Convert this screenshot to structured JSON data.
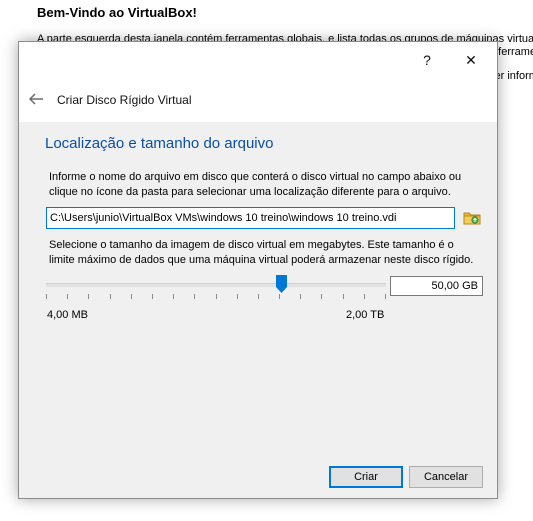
{
  "background": {
    "title": "Bem-Vindo ao VirtualBox!",
    "line1": "A parte esquerda desta janela contém ferramentas globais, e lista todas os grupos de máquinas virtuais",
    "frag1": "e ferrame",
    "frag2": "zer inform"
  },
  "dialog": {
    "help_label": "?",
    "close_label": "✕",
    "header_title": "Criar Disco Rígido Virtual",
    "page_title": "Localização e tamanho do arquivo",
    "description": "Informe o nome do arquivo em disco que conterá o disco virtual no campo abaixo ou clique no ícone da pasta para selecionar uma localização diferente para o arquivo.",
    "file_path": "C:\\Users\\junio\\VirtualBox VMs\\windows 10 treino\\windows 10 treino.vdi",
    "size_description": "Selecione o tamanho da imagem de disco virtual em megabytes. Este tamanho é o limite máximo de dados que uma máquina virtual poderá armazenar neste disco rígido.",
    "size_value": "50,00 GB",
    "slider_fraction": 0.7,
    "slider_min_label": "4,00 MB",
    "slider_max_label": "2,00 TB",
    "create_label": "Criar",
    "cancel_label": "Cancelar"
  },
  "icons": {
    "back": "back-arrow-icon",
    "folder": "folder-icon"
  },
  "colors": {
    "accent": "#0078d7",
    "page_title": "#0b4fa5"
  }
}
